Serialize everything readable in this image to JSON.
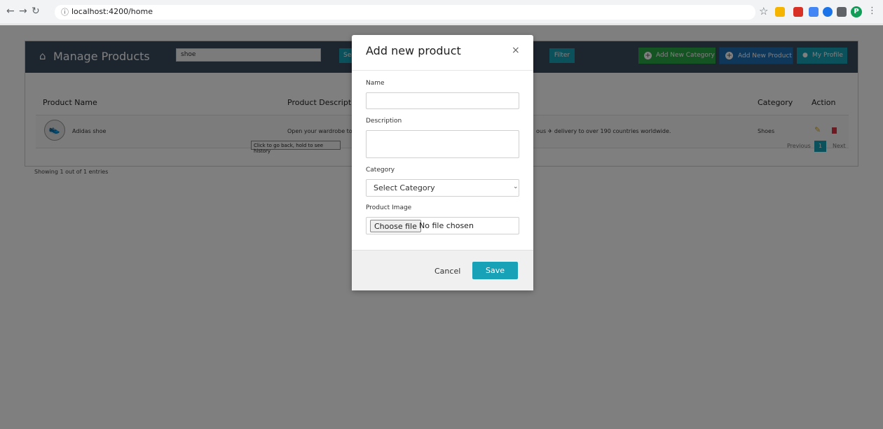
{
  "browser": {
    "url": "localhost:4200/home",
    "avatar_initial": "P"
  },
  "header": {
    "title": "Manage Products",
    "search_value": "shoe",
    "search_label": "Search",
    "filter_label": "Filter",
    "add_category_label": "Add New Category",
    "add_product_label": "Add New Product",
    "profile_label": "My Profile"
  },
  "table": {
    "col_name": "Product Name",
    "col_description": "Product Description",
    "col_category": "Category",
    "col_action": "Action",
    "row": {
      "name": "Adidas shoe",
      "description_start": "Open your wardrobe to",
      "description_end": "ous ✈ delivery to over 190 countries worldwide.",
      "category": "Shoes"
    }
  },
  "footer": {
    "showing": "Showing 1 out of 1 entries",
    "prev": "Previous",
    "page": "1",
    "next": "Next"
  },
  "tooltip": "Click to go back, hold to see history",
  "modal": {
    "title": "Add new product",
    "close": "×",
    "name_label": "Name",
    "description_label": "Description",
    "category_label": "Category",
    "category_selected": "Select Category",
    "image_label": "Product Image",
    "file_button": "Choose file",
    "file_status": "No file chosen",
    "cancel": "Cancel",
    "save": "Save"
  },
  "colors": {
    "header_bg": "#3a4b5e",
    "accent": "#17a2b8",
    "green": "#28a745",
    "blue": "#1f6fb5"
  }
}
